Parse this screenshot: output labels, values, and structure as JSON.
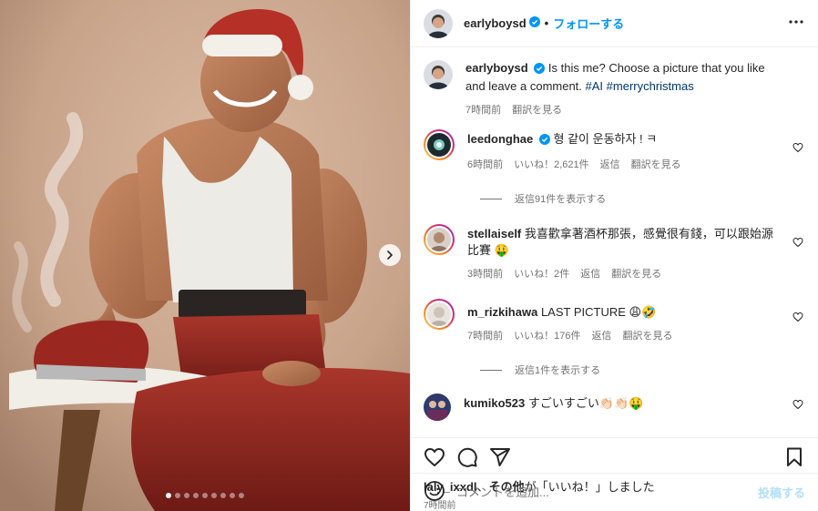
{
  "post": {
    "author": "earlyboysd",
    "follow_label": "フォローする",
    "separator": "•",
    "caption_text": "Is this me? Choose a picture that you like and leave a comment.",
    "caption_tags": "#AI #merrychristmas",
    "caption_time": "7時間前",
    "caption_translate": "翻訳を見る",
    "carousel_dots": 9,
    "carousel_active": 0
  },
  "comments": [
    {
      "user": "leedonghae",
      "verified": true,
      "text": "형 같이 운동하자 ! ㅋ",
      "time": "6時間前",
      "likes": "いいね！2,621件",
      "reply": "返信",
      "translate": "翻訳を見る",
      "view_replies": "返信91件を表示する"
    },
    {
      "user": "stellaiself",
      "verified": false,
      "text": "我喜歡拿著酒杯那張，感覺很有錢，可以跟始源比賽 🤑",
      "time": "3時間前",
      "likes": "いいね！2件",
      "reply": "返信",
      "translate": "翻訳を見る"
    },
    {
      "user": "m_rizkihawa",
      "verified": false,
      "text": "LAST PICTURE 😩🤣",
      "time": "7時間前",
      "likes": "いいね！176件",
      "reply": "返信",
      "translate": "翻訳を見る",
      "view_replies": "返信1件を表示する"
    },
    {
      "user": "kumiko523",
      "verified": false,
      "text": "すごいすごい👏🏻👏🏻🤑"
    }
  ],
  "footer": {
    "liked_by_user": "laly_ixxdl",
    "liked_by_sep": "、",
    "liked_by_others": "その他",
    "liked_by_suffix": "が「いいね！」しました",
    "time": "7時間前",
    "add_comment_placeholder": "コメントを追加...",
    "post_label": "投稿する"
  },
  "colors": {
    "accent": "#0095f6",
    "verified": "#0095f6",
    "muted": "#737373",
    "post_disabled": "#b2dffc"
  },
  "icons": {
    "next": "chevron-right-icon",
    "more": "more-horizontal-icon",
    "like": "heart-icon",
    "comment": "comment-icon",
    "share": "paper-plane-icon",
    "save": "bookmark-icon",
    "emoji": "smiley-icon"
  }
}
